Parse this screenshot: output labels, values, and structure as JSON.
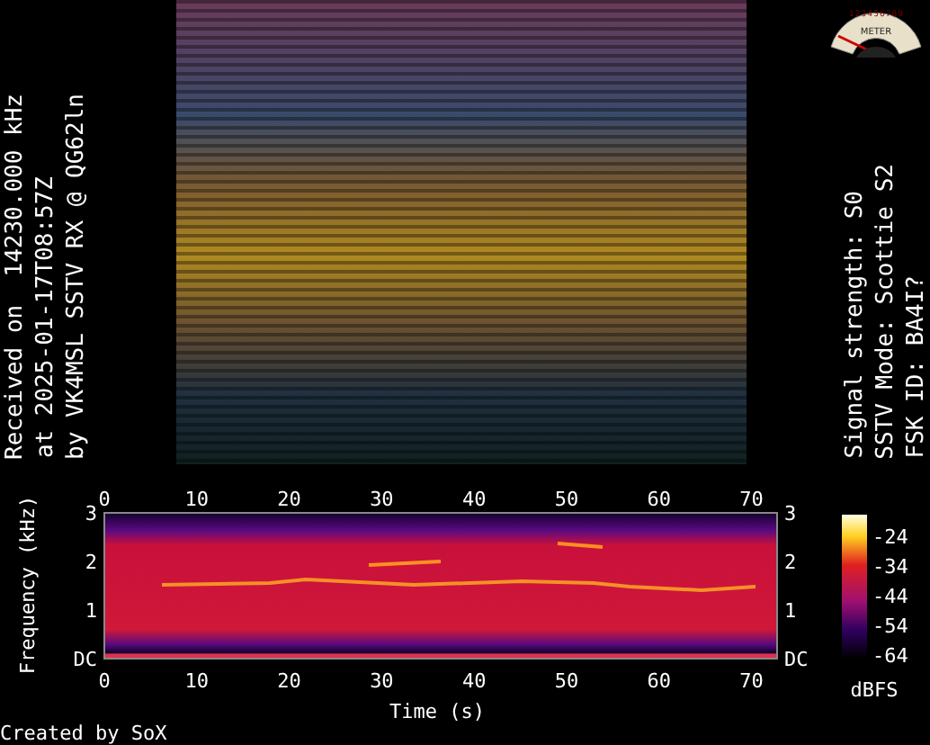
{
  "reception_info": [
    "Received on  14230.000 kHz",
    "at 2025-01-17T08:57Z",
    "by VK4MSL SSTV RX @ QG62ln"
  ],
  "meter": {
    "scale": "123456789",
    "label": "METER"
  },
  "decode_info": [
    "Signal strength: S0",
    "SSTV Mode: Scottie S2",
    "FSK ID: BA4I?"
  ],
  "spectrogram": {
    "top_ticks": [
      "0",
      "10",
      "20",
      "30",
      "40",
      "50",
      "60",
      "70"
    ],
    "left_ticks": [
      "3",
      "2",
      "1",
      "DC"
    ],
    "right_ticks": [
      "3",
      "2",
      "1",
      "DC"
    ],
    "bottom_ticks": [
      "0",
      "10",
      "20",
      "30",
      "40",
      "50",
      "60",
      "70"
    ],
    "x_label": "Time (s)",
    "y_label": "Frequency (kHz)",
    "colorbar_ticks": [
      "-24",
      "-34",
      "-44",
      "-54",
      "-64"
    ],
    "colorbar_unit": "dBFS"
  },
  "footer": "Created by SoX"
}
